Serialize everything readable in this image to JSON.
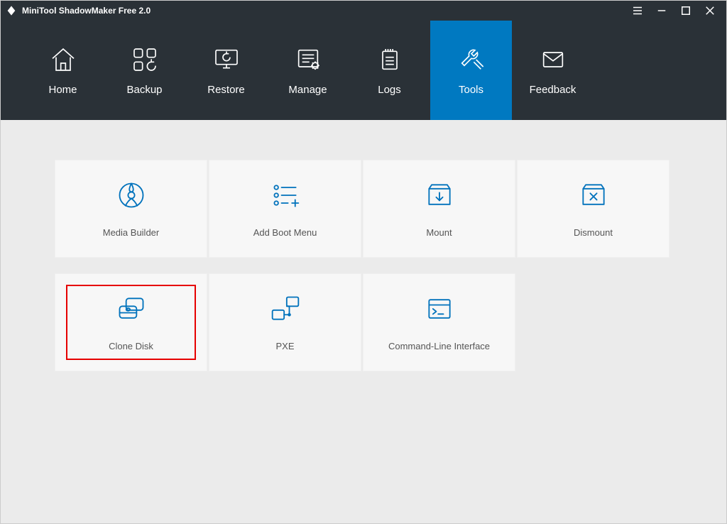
{
  "app": {
    "title": "MiniTool ShadowMaker Free 2.0"
  },
  "nav": {
    "items": [
      {
        "label": "Home"
      },
      {
        "label": "Backup"
      },
      {
        "label": "Restore"
      },
      {
        "label": "Manage"
      },
      {
        "label": "Logs"
      },
      {
        "label": "Tools",
        "active": true
      },
      {
        "label": "Feedback"
      }
    ]
  },
  "tools": {
    "tiles": [
      {
        "label": "Media Builder"
      },
      {
        "label": "Add Boot Menu"
      },
      {
        "label": "Mount"
      },
      {
        "label": "Dismount"
      },
      {
        "label": "Clone Disk",
        "highlight": true
      },
      {
        "label": "PXE"
      },
      {
        "label": "Command-Line Interface"
      }
    ]
  },
  "colors": {
    "accent": "#0079c1",
    "iconBlue": "#0072bc",
    "highlight": "#e60000"
  }
}
